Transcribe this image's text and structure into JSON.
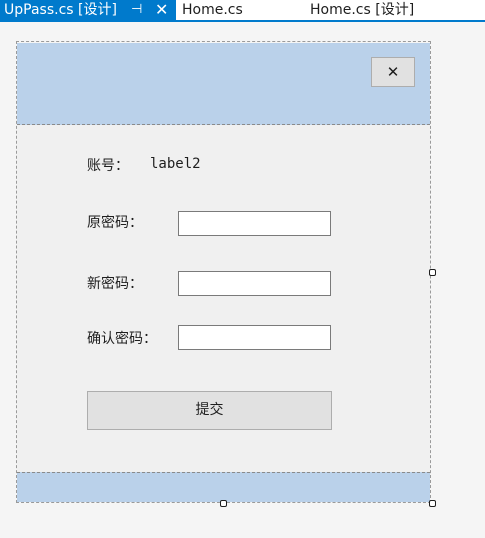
{
  "tabs": [
    {
      "label": "UpPass.cs [设计]",
      "active": true
    },
    {
      "label": "Home.cs",
      "active": false
    },
    {
      "label": "Home.cs [设计]",
      "active": false
    }
  ],
  "icons": {
    "pin": "⊣",
    "tab_close": "✕",
    "form_close": "✕"
  },
  "form": {
    "account_label": "账号：",
    "account_value": "label2",
    "old_password_label": "原密码：",
    "new_password_label": "新密码：",
    "confirm_password_label": "确认密码：",
    "old_password_value": "",
    "new_password_value": "",
    "confirm_password_value": "",
    "submit_label": "提交"
  },
  "colors": {
    "accent": "#007acc",
    "panel": "#bad1ea",
    "form_bg": "#f0f0f0"
  }
}
